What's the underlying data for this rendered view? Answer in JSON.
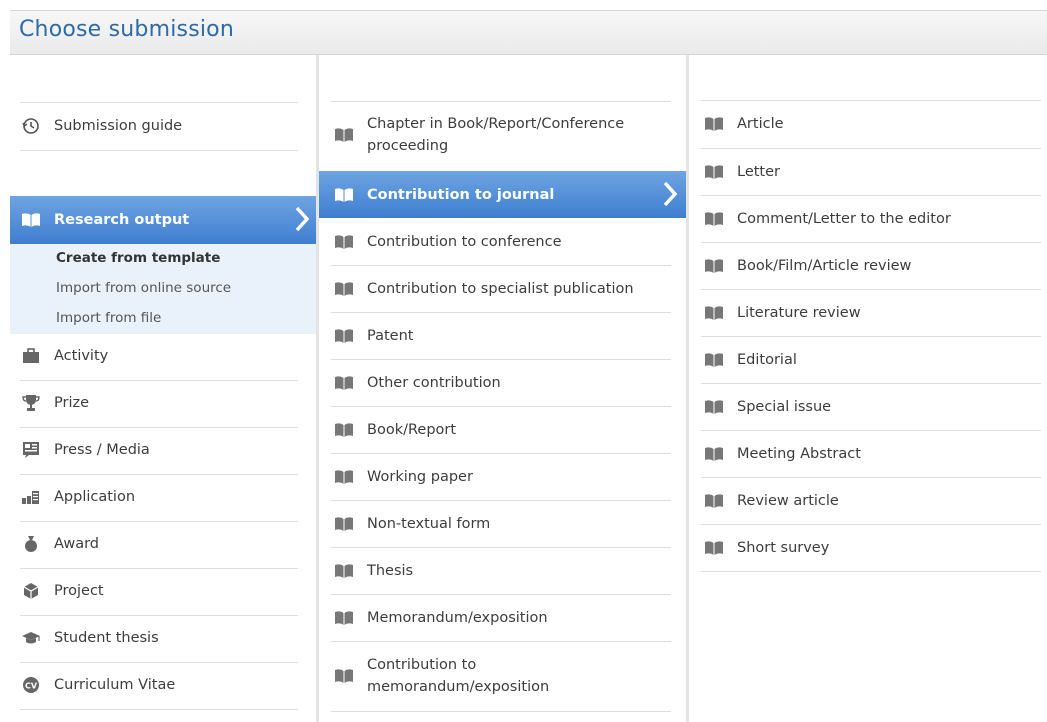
{
  "header": {
    "title": "Choose submission"
  },
  "col1": {
    "submission_guide": "Submission guide",
    "research_output": "Research output",
    "sub_items": [
      "Create from template",
      "Import from online source",
      "Import from file"
    ],
    "items": [
      "Activity",
      "Prize",
      "Press / Media",
      "Application",
      "Award",
      "Project",
      "Student thesis",
      "Curriculum Vitae"
    ]
  },
  "col2": {
    "items": [
      "Chapter in Book/Report/Conference proceeding",
      "Contribution to journal",
      "Contribution to conference",
      "Contribution to specialist publication",
      "Patent",
      "Other contribution",
      "Book/Report",
      "Working paper",
      "Non-textual form",
      "Thesis",
      "Memorandum/exposition",
      "Contribution to memorandum/exposition"
    ],
    "chapter_line1": "Chapter in Book/Report/Conference",
    "chapter_line2": "proceeding",
    "memo_line1": "Contribution to",
    "memo_line2": "memorandum/exposition"
  },
  "col3": {
    "items": [
      "Article",
      "Letter",
      "Comment/Letter to the editor",
      "Book/Film/Article review",
      "Literature review",
      "Editorial",
      "Special issue",
      "Meeting Abstract",
      "Review article",
      "Short survey"
    ]
  },
  "icons": {
    "guide": "history-icon",
    "book": "book-icon",
    "activity": "briefcase-icon",
    "prize": "trophy-icon",
    "press": "newspaper-icon",
    "application": "bar-chart-icon",
    "award": "medal-icon",
    "project": "cube-icon",
    "thesis": "graduation-cap-icon",
    "cv": "cv-badge-icon",
    "chevron": "chevron-right-icon"
  },
  "colors": {
    "accent": "#4a89d8",
    "title": "#2c6aa8",
    "sub_panel": "#e9f1fb"
  }
}
